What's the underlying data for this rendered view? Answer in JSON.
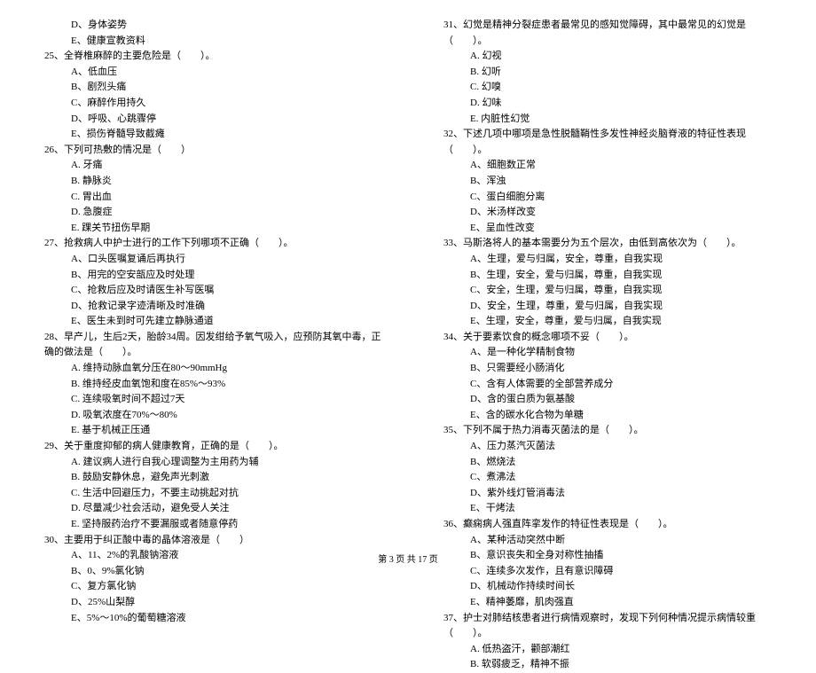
{
  "left": {
    "pre_opts": [
      "D、身体姿势",
      "E、健康宣教资料"
    ],
    "q25": {
      "stem": "25、全脊椎麻醉的主要危险是（　　）。",
      "opts": [
        "A、低血压",
        "B、剧烈头痛",
        "C、麻醉作用持久",
        "D、呼吸、心跳骤停",
        "E、损伤脊髓导致截瘫"
      ]
    },
    "q26": {
      "stem": "26、下列可热敷的情况是（　　）",
      "opts": [
        "A. 牙痛",
        "B. 静脉炎",
        "C. 胃出血",
        "D. 急腹症",
        "E. 踝关节扭伤早期"
      ]
    },
    "q27": {
      "stem": "27、抢救病人中护士进行的工作下列哪项不正确（　　）。",
      "opts": [
        "A、口头医嘱复诵后再执行",
        "B、用完的空安瓿应及时处理",
        "C、抢救后应及时请医生补写医嘱",
        "D、抢救记录字迹清晰及时准确",
        "E、医生未到时可先建立静脉通道"
      ]
    },
    "q28": {
      "stem": "28、早产儿，生后2天，胎龄34周。因发绀给予氧气吸入，应预防其氧中毒，正确的做法是（　　）。",
      "opts": [
        "A. 维持动脉血氧分压在80～90mmHg",
        "B. 维持经皮血氧饱和度在85%～93%",
        "C. 连续吸氧时间不超过7天",
        "D. 吸氧浓度在70%～80%",
        "E. 基于机械正压通"
      ]
    },
    "q29": {
      "stem": "29、关于重度抑郁的病人健康教育，正确的是（　　）。",
      "opts": [
        "A. 建议病人进行自我心理调整为主用药为辅",
        "B. 鼓励安静休息，避免声光刺激",
        "C. 生活中回避压力，不要主动挑起对抗",
        "D. 尽量减少社会活动，避免受人关注",
        "E. 坚持服药治疗不要漏服或者随意停药"
      ]
    },
    "q30": {
      "stem": "30、主要用于纠正酸中毒的晶体溶液是（　　）",
      "opts": [
        "A、11、2%的乳酸钠溶液",
        "B、0、9%氯化钠",
        "C、复方氯化钠",
        "D、25%山梨醇",
        "E、5%～10%的葡萄糖溶液"
      ]
    }
  },
  "right": {
    "q31": {
      "stem": "31、幻觉是精神分裂症患者最常见的感知觉障碍，其中最常见的幻觉是（　　）。",
      "opts": [
        "A. 幻视",
        "B. 幻听",
        "C. 幻嗅",
        "D. 幻味",
        "E. 内脏性幻觉"
      ]
    },
    "q32": {
      "stem": "32、下述几项中哪项是急性脱髓鞘性多发性神经炎脑脊液的特征性表现（　　）。",
      "opts": [
        "A、细胞数正常",
        "B、浑浊",
        "C、蛋白细胞分离",
        "D、米汤样改变",
        "E、呈血性改变"
      ]
    },
    "q33": {
      "stem": "33、马斯洛将人的基本需要分为五个层次，由低到高依次为（　　）。",
      "opts": [
        "A、生理，爱与归属，安全，尊重，自我实现",
        "B、生理，安全，爱与归属，尊重，自我实现",
        "C、安全，生理，爱与归属，尊重，自我实现",
        "D、安全，生理，尊重，爱与归属，自我实现",
        "E、生理，安全，尊重，爱与归属，自我实现"
      ]
    },
    "q34": {
      "stem": "34、关于要素饮食的概念哪项不妥（　　）。",
      "opts": [
        "A、是一种化学精制食物",
        "B、只需要经小肠消化",
        "C、含有人体需要的全部营养成分",
        "D、含的蛋白质为氨基酸",
        "E、含的碳水化合物为单糖"
      ]
    },
    "q35": {
      "stem": "35、下列不属于热力消毒灭菌法的是（　　）。",
      "opts": [
        "A、压力蒸汽灭菌法",
        "B、燃烧法",
        "C、煮沸法",
        "D、紫外线灯管消毒法",
        "E、干烤法"
      ]
    },
    "q36": {
      "stem": "36、癫痫病人强直阵挛发作的特征性表现是（　　）。",
      "opts": [
        "A、某种活动突然中断",
        "B、意识丧失和全身对称性抽搐",
        "C、连续多次发作，且有意识障碍",
        "D、机械动作持续时间长",
        "E、精神萎靡，肌肉强直"
      ]
    },
    "q37": {
      "stem": "37、护士对肺结核患者进行病情观察时，发现下列何种情况提示病情较重（　　）。",
      "opts": [
        "A. 低热盗汗，颧部潮红",
        "B. 软弱疲乏，精神不振"
      ]
    }
  },
  "footer": "第 3 页 共 17 页"
}
